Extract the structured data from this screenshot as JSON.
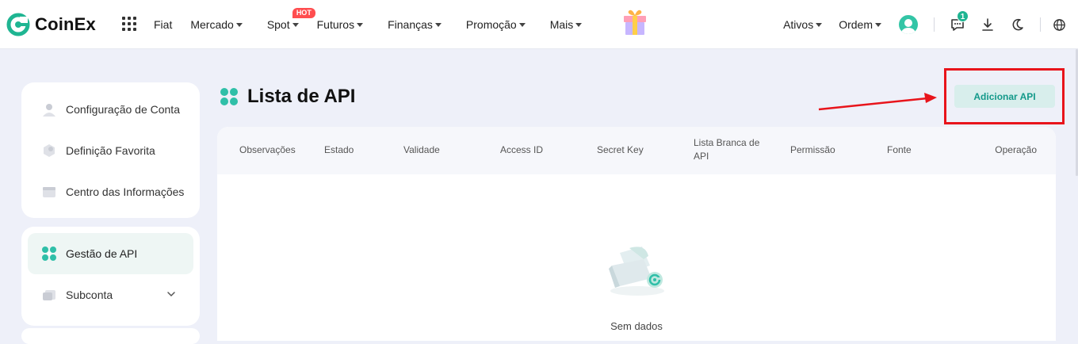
{
  "brand": {
    "name": "CoinEx",
    "accent": "#1fb592"
  },
  "nav": {
    "fiat": "Fiat",
    "mercado": "Mercado",
    "spot": "Spot",
    "hot_badge": "HOT",
    "futuros": "Futuros",
    "financas": "Finanças",
    "promocao": "Promoção",
    "mais": "Mais"
  },
  "right_nav": {
    "ativos": "Ativos",
    "ordem": "Ordem",
    "message_count": "1"
  },
  "sidebar": {
    "group1": [
      {
        "label": "Configuração de Conta",
        "icon": "user-icon"
      },
      {
        "label": "Definição Favorita",
        "icon": "favorite-icon"
      },
      {
        "label": "Centro das Informações",
        "icon": "info-center-icon"
      }
    ],
    "group2": [
      {
        "label": "Gestão de API",
        "icon": "api-icon",
        "active": true
      },
      {
        "label": "Subconta",
        "icon": "subaccount-icon"
      }
    ]
  },
  "main": {
    "title": "Lista de API",
    "add_button": "Adicionar API",
    "table": {
      "headers": [
        "Observações",
        "Estado",
        "Validade",
        "Access ID",
        "Secret Key",
        "Lista Branca de API",
        "Permissão",
        "Fonte",
        "Operação"
      ],
      "empty_text": "Sem dados"
    }
  }
}
